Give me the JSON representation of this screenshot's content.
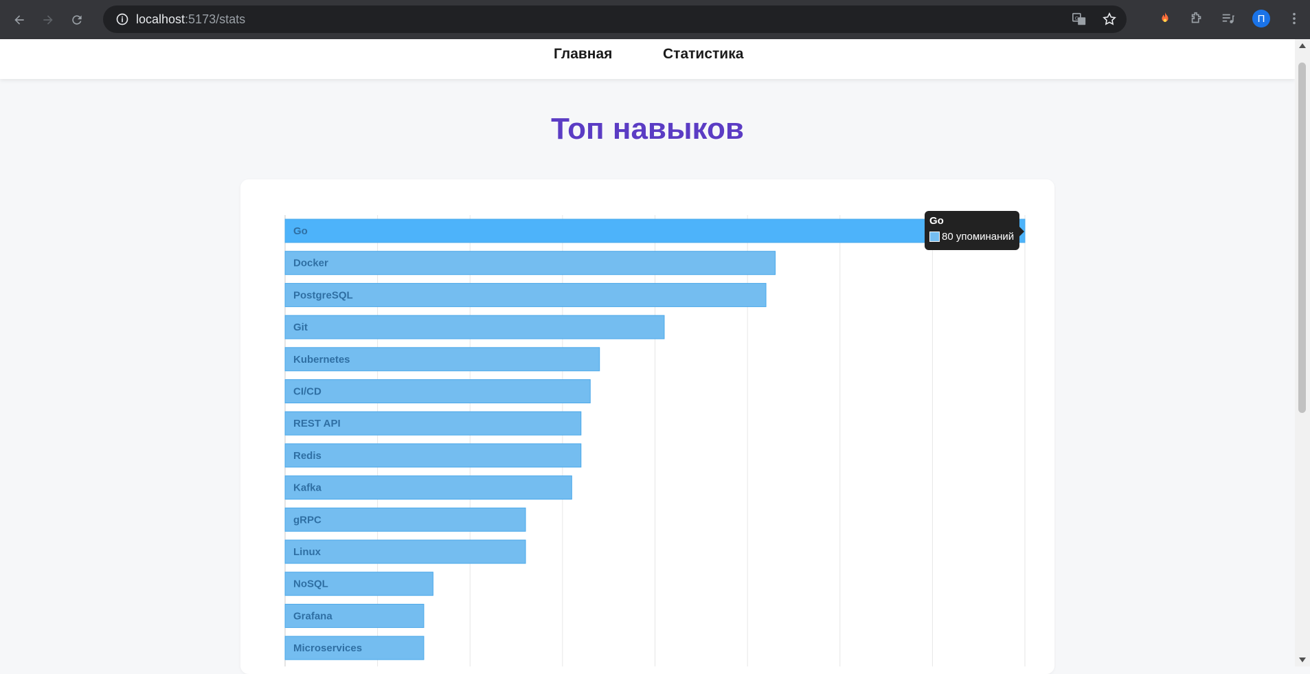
{
  "browser": {
    "url_host": "localhost",
    "url_path": ":5173/stats",
    "profile_initial": "П"
  },
  "nav": {
    "home": "Главная",
    "stats": "Статистика"
  },
  "page": {
    "title": "Топ навыков"
  },
  "tooltip": {
    "title": "Go",
    "value_text": "80 упоминаний"
  },
  "colors": {
    "bar": "#74bdf0",
    "bar_hover": "#4db3fa",
    "bar_border": "#4aa8ea",
    "title": "#5b3cc4"
  },
  "chart_data": {
    "type": "bar",
    "orientation": "horizontal",
    "categories": [
      "Go",
      "Docker",
      "PostgreSQL",
      "Git",
      "Kubernetes",
      "CI/CD",
      "REST API",
      "Redis",
      "Kafka",
      "gRPC",
      "Linux",
      "NoSQL",
      "Grafana",
      "Microservices"
    ],
    "values": [
      80,
      53,
      52,
      41,
      34,
      33,
      32,
      32,
      31,
      26,
      26,
      16,
      15,
      15
    ],
    "xlim": [
      0,
      80
    ],
    "highlighted": "Go",
    "grid": true
  }
}
